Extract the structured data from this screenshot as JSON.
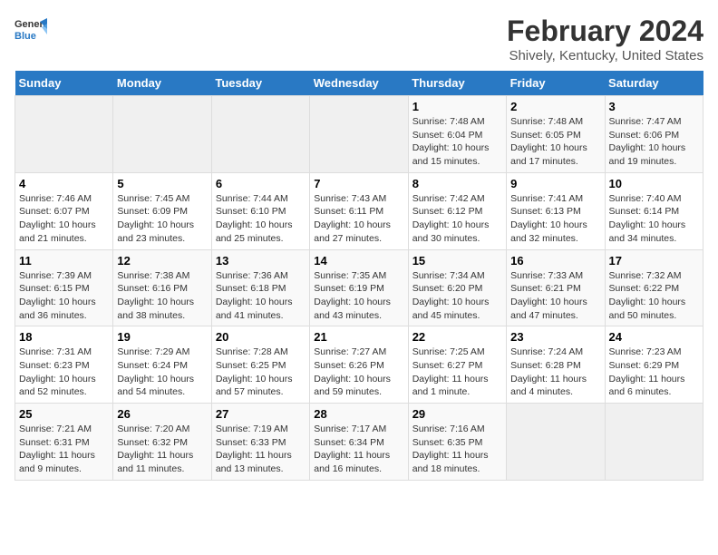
{
  "header": {
    "logo_line1": "General",
    "logo_line2": "Blue",
    "title": "February 2024",
    "subtitle": "Shively, Kentucky, United States"
  },
  "days_of_week": [
    "Sunday",
    "Monday",
    "Tuesday",
    "Wednesday",
    "Thursday",
    "Friday",
    "Saturday"
  ],
  "weeks": [
    [
      {
        "day": "",
        "empty": true
      },
      {
        "day": "",
        "empty": true
      },
      {
        "day": "",
        "empty": true
      },
      {
        "day": "",
        "empty": true
      },
      {
        "day": "1",
        "sunrise": "7:48 AM",
        "sunset": "6:04 PM",
        "daylight": "10 hours and 15 minutes."
      },
      {
        "day": "2",
        "sunrise": "7:48 AM",
        "sunset": "6:05 PM",
        "daylight": "10 hours and 17 minutes."
      },
      {
        "day": "3",
        "sunrise": "7:47 AM",
        "sunset": "6:06 PM",
        "daylight": "10 hours and 19 minutes."
      }
    ],
    [
      {
        "day": "4",
        "sunrise": "7:46 AM",
        "sunset": "6:07 PM",
        "daylight": "10 hours and 21 minutes."
      },
      {
        "day": "5",
        "sunrise": "7:45 AM",
        "sunset": "6:09 PM",
        "daylight": "10 hours and 23 minutes."
      },
      {
        "day": "6",
        "sunrise": "7:44 AM",
        "sunset": "6:10 PM",
        "daylight": "10 hours and 25 minutes."
      },
      {
        "day": "7",
        "sunrise": "7:43 AM",
        "sunset": "6:11 PM",
        "daylight": "10 hours and 27 minutes."
      },
      {
        "day": "8",
        "sunrise": "7:42 AM",
        "sunset": "6:12 PM",
        "daylight": "10 hours and 30 minutes."
      },
      {
        "day": "9",
        "sunrise": "7:41 AM",
        "sunset": "6:13 PM",
        "daylight": "10 hours and 32 minutes."
      },
      {
        "day": "10",
        "sunrise": "7:40 AM",
        "sunset": "6:14 PM",
        "daylight": "10 hours and 34 minutes."
      }
    ],
    [
      {
        "day": "11",
        "sunrise": "7:39 AM",
        "sunset": "6:15 PM",
        "daylight": "10 hours and 36 minutes."
      },
      {
        "day": "12",
        "sunrise": "7:38 AM",
        "sunset": "6:16 PM",
        "daylight": "10 hours and 38 minutes."
      },
      {
        "day": "13",
        "sunrise": "7:36 AM",
        "sunset": "6:18 PM",
        "daylight": "10 hours and 41 minutes."
      },
      {
        "day": "14",
        "sunrise": "7:35 AM",
        "sunset": "6:19 PM",
        "daylight": "10 hours and 43 minutes."
      },
      {
        "day": "15",
        "sunrise": "7:34 AM",
        "sunset": "6:20 PM",
        "daylight": "10 hours and 45 minutes."
      },
      {
        "day": "16",
        "sunrise": "7:33 AM",
        "sunset": "6:21 PM",
        "daylight": "10 hours and 47 minutes."
      },
      {
        "day": "17",
        "sunrise": "7:32 AM",
        "sunset": "6:22 PM",
        "daylight": "10 hours and 50 minutes."
      }
    ],
    [
      {
        "day": "18",
        "sunrise": "7:31 AM",
        "sunset": "6:23 PM",
        "daylight": "10 hours and 52 minutes."
      },
      {
        "day": "19",
        "sunrise": "7:29 AM",
        "sunset": "6:24 PM",
        "daylight": "10 hours and 54 minutes."
      },
      {
        "day": "20",
        "sunrise": "7:28 AM",
        "sunset": "6:25 PM",
        "daylight": "10 hours and 57 minutes."
      },
      {
        "day": "21",
        "sunrise": "7:27 AM",
        "sunset": "6:26 PM",
        "daylight": "10 hours and 59 minutes."
      },
      {
        "day": "22",
        "sunrise": "7:25 AM",
        "sunset": "6:27 PM",
        "daylight": "11 hours and 1 minute."
      },
      {
        "day": "23",
        "sunrise": "7:24 AM",
        "sunset": "6:28 PM",
        "daylight": "11 hours and 4 minutes."
      },
      {
        "day": "24",
        "sunrise": "7:23 AM",
        "sunset": "6:29 PM",
        "daylight": "11 hours and 6 minutes."
      }
    ],
    [
      {
        "day": "25",
        "sunrise": "7:21 AM",
        "sunset": "6:31 PM",
        "daylight": "11 hours and 9 minutes."
      },
      {
        "day": "26",
        "sunrise": "7:20 AM",
        "sunset": "6:32 PM",
        "daylight": "11 hours and 11 minutes."
      },
      {
        "day": "27",
        "sunrise": "7:19 AM",
        "sunset": "6:33 PM",
        "daylight": "11 hours and 13 minutes."
      },
      {
        "day": "28",
        "sunrise": "7:17 AM",
        "sunset": "6:34 PM",
        "daylight": "11 hours and 16 minutes."
      },
      {
        "day": "29",
        "sunrise": "7:16 AM",
        "sunset": "6:35 PM",
        "daylight": "11 hours and 18 minutes."
      },
      {
        "day": "",
        "empty": true
      },
      {
        "day": "",
        "empty": true
      }
    ]
  ],
  "labels": {
    "sunrise_prefix": "Sunrise: ",
    "sunset_prefix": "Sunset: ",
    "daylight_prefix": "Daylight: "
  }
}
